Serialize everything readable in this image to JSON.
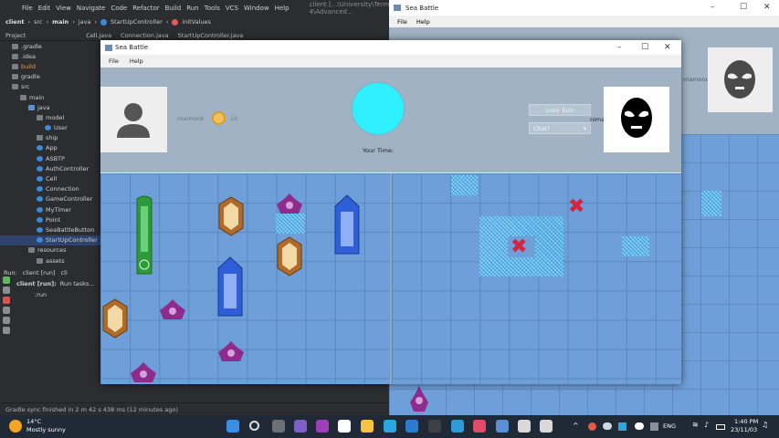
{
  "ide": {
    "menu": [
      "File",
      "Edit",
      "View",
      "Navigate",
      "Code",
      "Refactor",
      "Build",
      "Run",
      "Tools",
      "VCS",
      "Window",
      "Help"
    ],
    "title_path": "client [...\\University\\Term-4\\Advanced...",
    "breadcrumb": [
      "client",
      "src",
      "main",
      "java",
      "StartUpController",
      "initValues"
    ],
    "project_label": "Project",
    "editor_tabs": [
      "Cell.java",
      "Connection.java",
      "StartUpController.java"
    ],
    "tree": [
      {
        "label": ".gradle",
        "indent": 1,
        "kind": "folder"
      },
      {
        "label": ".idea",
        "indent": 1,
        "kind": "folder"
      },
      {
        "label": "build",
        "indent": 1,
        "kind": "folder-orange"
      },
      {
        "label": "gradle",
        "indent": 1,
        "kind": "folder"
      },
      {
        "label": "src",
        "indent": 1,
        "kind": "folder"
      },
      {
        "label": "main",
        "indent": 2,
        "kind": "folder"
      },
      {
        "label": "java",
        "indent": 3,
        "kind": "folder-blue"
      },
      {
        "label": "model",
        "indent": 4,
        "kind": "folder"
      },
      {
        "label": "User",
        "indent": 5,
        "kind": "class"
      },
      {
        "label": "ship",
        "indent": 4,
        "kind": "folder"
      },
      {
        "label": "App",
        "indent": 4,
        "kind": "class"
      },
      {
        "label": "ASBTP",
        "indent": 4,
        "kind": "class"
      },
      {
        "label": "AuthController",
        "indent": 4,
        "kind": "class"
      },
      {
        "label": "Cell",
        "indent": 4,
        "kind": "class"
      },
      {
        "label": "Connection",
        "indent": 4,
        "kind": "class"
      },
      {
        "label": "GameController",
        "indent": 4,
        "kind": "class"
      },
      {
        "label": "MyTimer",
        "indent": 4,
        "kind": "class"
      },
      {
        "label": "Point",
        "indent": 4,
        "kind": "class"
      },
      {
        "label": "SeaBattleButton",
        "indent": 4,
        "kind": "class"
      },
      {
        "label": "StartUpController",
        "indent": 4,
        "kind": "class",
        "selected": true
      },
      {
        "label": "resources",
        "indent": 3,
        "kind": "folder"
      },
      {
        "label": "assets",
        "indent": 4,
        "kind": "folder"
      }
    ],
    "run_label": "Run:",
    "run_tabs": [
      "client [run]",
      "cli"
    ],
    "run_tree_root": "client [run]:",
    "run_tree_child_1": "Run tasks...",
    "run_tree_child_2": ":run",
    "status_text": "Gradle sync finished in 2 m 42 s 438 ms (12 minutes ago)"
  },
  "back_window": {
    "title": "Sea Battle",
    "menu": [
      "File",
      "Help"
    ],
    "opponent_name": "mamood"
  },
  "main_window": {
    "title": "Sea Battle",
    "menu": [
      "File",
      "Help"
    ],
    "player_name": "mamood",
    "coins": "10",
    "timer_label": "Your Time:",
    "lose_turn_button": "Lose Turn",
    "chat_select": "Chat!",
    "opponent_name": "nima",
    "colors": {
      "timer_circle": "#2ef0ff",
      "board": "#6f9fd8",
      "header": "#a1b2c4",
      "hit_mark": "#d6233f"
    }
  },
  "taskbar": {
    "weather_temp": "14°C",
    "weather_desc": "Mostly sunny",
    "language": "ENG",
    "time": "1:40 PM",
    "date": "23/11/03"
  }
}
